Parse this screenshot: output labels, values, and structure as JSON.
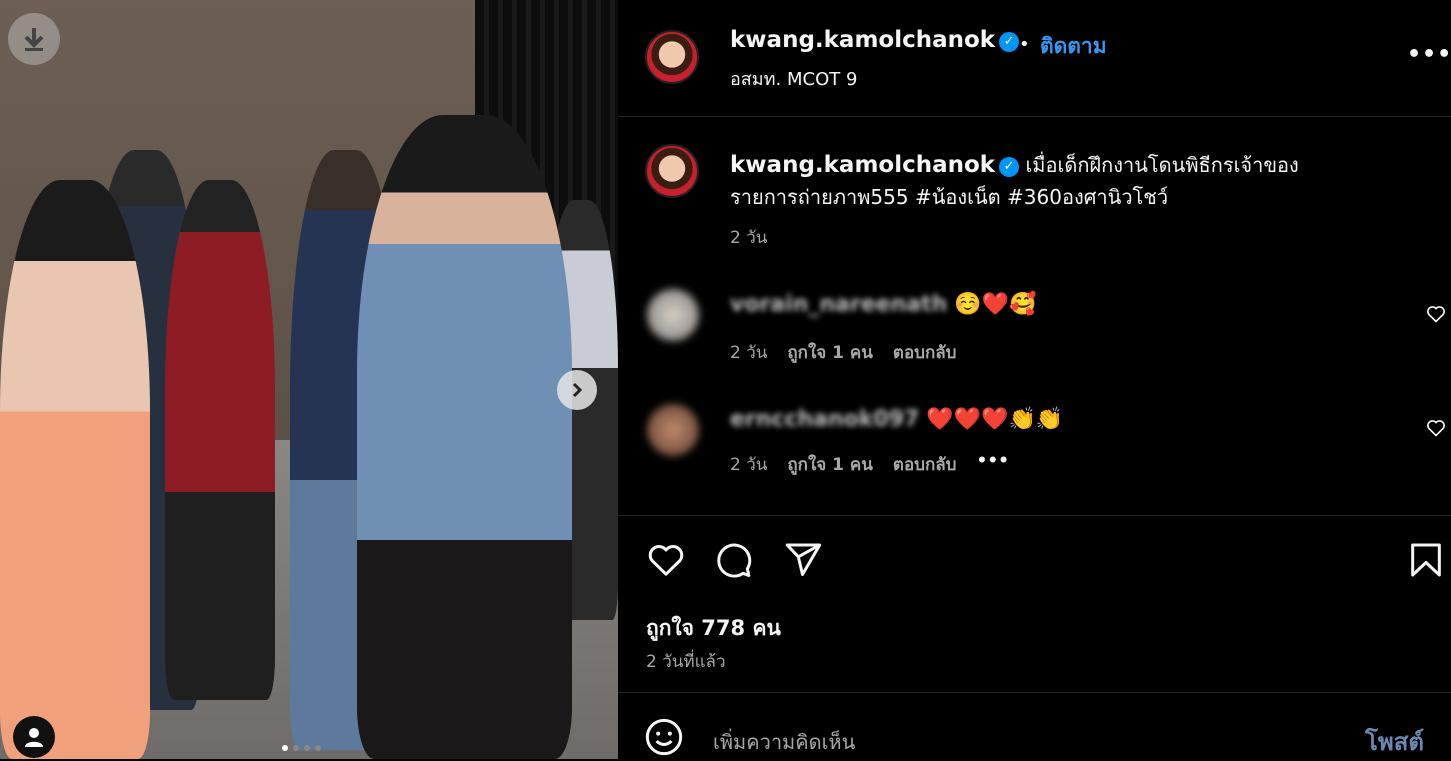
{
  "post": {
    "username": "kwang.kamolchanok",
    "follow_separator": "•",
    "follow_label": "ติดตาม",
    "location": "อสมท. MCOT 9",
    "caption_line1": "เมื่อเด็กฝึกงานโดนพิธีกรเจ้าของ",
    "caption_line2": "รายการถ่ายภาพ555 #น้องเน็ต #360องศานิวโชว์",
    "caption_time": "2 วัน"
  },
  "comments": [
    {
      "username": "vorain_nareenath",
      "emoji_text": "☺️❤️🥰",
      "time": "2 วัน",
      "likes": "ถูกใจ 1 คน",
      "reply": "ตอบกลับ"
    },
    {
      "username": "erncchanok097",
      "emoji_text": "❤️❤️❤️👏👏",
      "time": "2 วัน",
      "likes": "ถูกใจ 1 คน",
      "reply": "ตอบกลับ",
      "more": "•••"
    }
  ],
  "actions": {
    "like_count": "ถูกใจ 778 คน",
    "posted_ago": "2 วันที่แล้ว"
  },
  "comment_box": {
    "placeholder": "เพิ่มความคิดเห็น",
    "post_label": "โพสต์"
  },
  "header_more": "•••",
  "colors": {
    "background": "#000000",
    "link_blue": "#3897f0",
    "verified_blue": "#0095f6",
    "muted_text": "#a8a8a8",
    "divider": "#262626"
  },
  "carousel": {
    "slide_count": 4,
    "active_slide": 1
  }
}
